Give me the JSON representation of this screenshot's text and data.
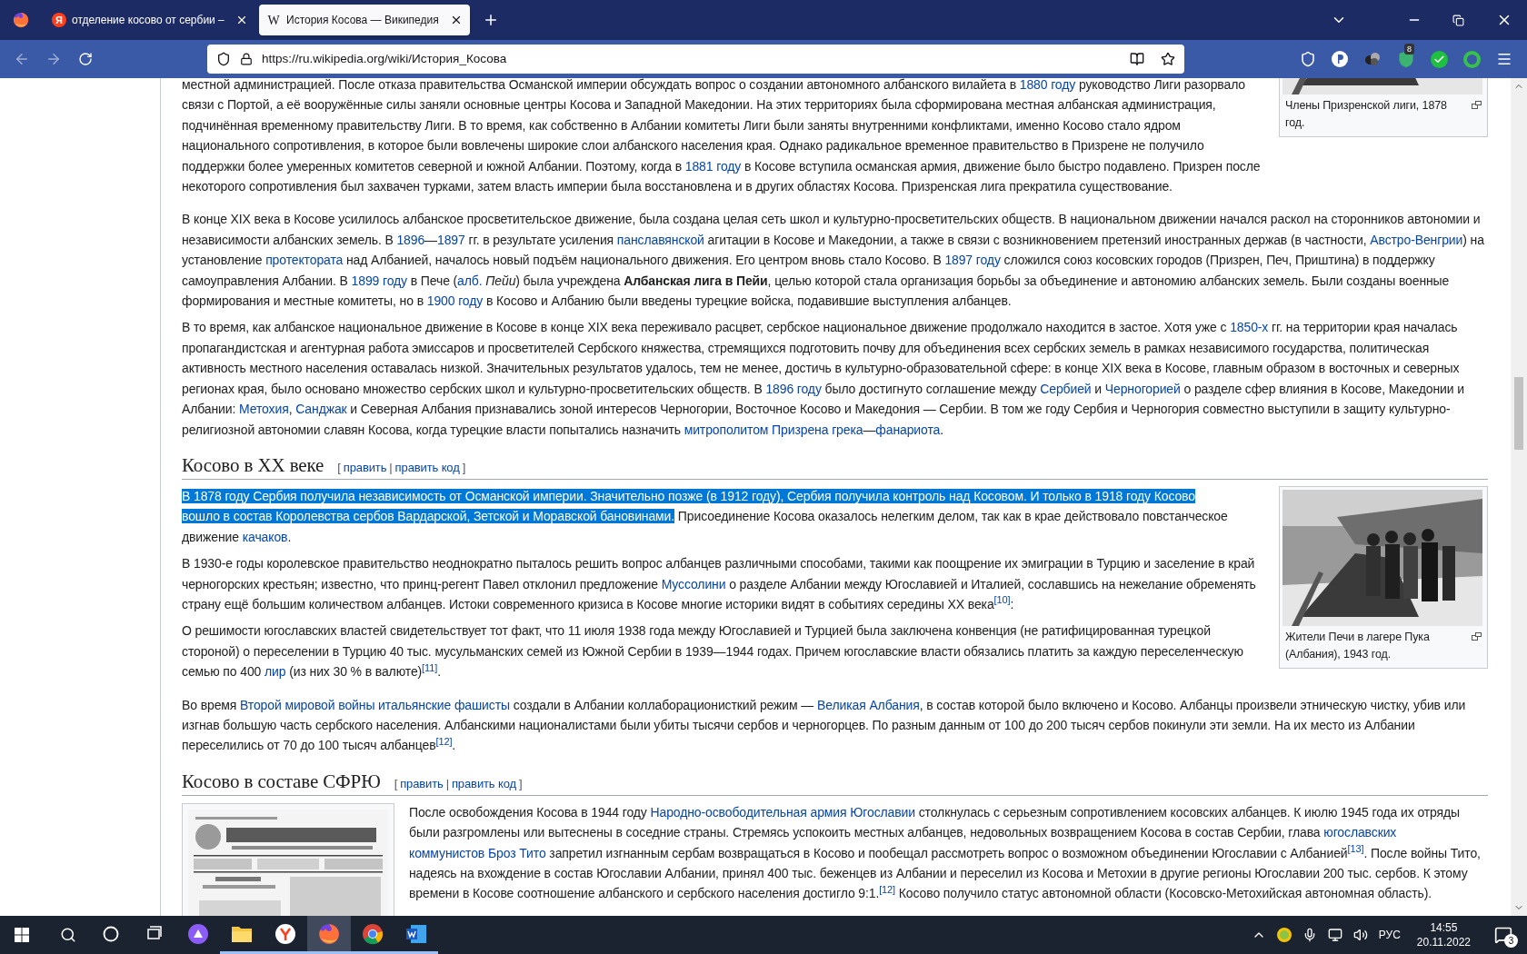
{
  "browser": {
    "tabs": [
      {
        "favicon": "Я",
        "title": "отделение косово от сербии –",
        "selected": false
      },
      {
        "favicon": "W",
        "title": "История Косова — Википедия",
        "selected": true
      }
    ],
    "url": "https://ru.wikipedia.org/wiki/История_Косова",
    "extension_badge": "8"
  },
  "article": {
    "intro": {
      "figure": {
        "caption": "Члены Призренской лиги, 1878 год."
      },
      "paragraphs": [
        {
          "segments": [
            {
              "kind": "text",
              "text": "местной администрацией. После отказа правительства Османской империи обсуждать вопрос о создании автономного албанского вилайета в "
            },
            {
              "kind": "link",
              "text": "1880 году"
            },
            {
              "kind": "text",
              "text": " руководство Лиги разорвало связи с Портой, а её вооружённые силы заняли основные центры Косова и Западной Македонии. На этих территориях была сформирована местная албанская администрация, подчинённая временному правительству Лиги. В то время, как собственно в Албании комитеты Лиги были заняты внутренними конфликтами, именно Косово стало ядром национального сопротивления, в которое были вовлечены широкие слои албанского населения края. Однако радикальное временное правительство в Призрене не получило поддержки более умеренных комитетов северной и южной Албании. Поэтому, когда в "
            },
            {
              "kind": "link",
              "text": "1881 году"
            },
            {
              "kind": "text",
              "text": " в Косове вступила османская армия, движение было быстро подавлено. Призрен после некоторого сопротивления был захвачен турками, затем власть империи была восстановлена и в других областях Косова. Призренская лига прекратила существование."
            }
          ]
        },
        {
          "segments": [
            {
              "kind": "text",
              "text": "В конце XIX века в Косове усилилось албанское просветительское движение, была создана целая сеть школ и культурно-просветительских обществ. В национальном движении начался раскол на сторонников автономии и независимости албанских земель. В "
            },
            {
              "kind": "link",
              "text": "1896"
            },
            {
              "kind": "text",
              "text": "—"
            },
            {
              "kind": "link",
              "text": "1897"
            },
            {
              "kind": "text",
              "text": " гг. в результате усиления "
            },
            {
              "kind": "link",
              "text": "панславянской"
            },
            {
              "kind": "text",
              "text": " агитации в Косове и Македонии, а также в связи с возникновением претензий иностранных держав (в частности, "
            },
            {
              "kind": "link",
              "text": "Австро-Венгрии"
            },
            {
              "kind": "text",
              "text": ") на установление "
            },
            {
              "kind": "link",
              "text": "протектората"
            },
            {
              "kind": "text",
              "text": " над Албанией, началось новый подъём национального движения. Его центром вновь стало Косово. В "
            },
            {
              "kind": "link",
              "text": "1897 году"
            },
            {
              "kind": "text",
              "text": " сложился союз косовских городов (Призрен, Печ, Приштина) в поддержку самоуправления Албании. В "
            },
            {
              "kind": "link",
              "text": "1899 году"
            },
            {
              "kind": "text",
              "text": " в Пече ("
            },
            {
              "kind": "link",
              "text": "алб."
            },
            {
              "kind": "space"
            },
            {
              "kind": "italic",
              "text": "Пейи"
            },
            {
              "kind": "text",
              "text": ") была учреждена "
            },
            {
              "kind": "bold",
              "text": "Албанская лига в Пейи"
            },
            {
              "kind": "text",
              "text": ", целью которой стала организация борьбы за объединение и автономию албанских земель. Были созданы военные формирования и местные комитеты, но в "
            },
            {
              "kind": "link",
              "text": "1900 году"
            },
            {
              "kind": "text",
              "text": " в Косово и Албанию были введены турецкие войска, подавившие выступления албанцев."
            }
          ]
        },
        {
          "segments": [
            {
              "kind": "text",
              "text": "В то время, как албанское национальное движение в Косове в конце XIX века переживало расцвет, сербское национальное движение продолжало находится в застое. Хотя уже с "
            },
            {
              "kind": "link",
              "text": "1850-х"
            },
            {
              "kind": "text",
              "text": " гг. на территории края началась пропагандистская и агентурная работа эмиссаров и просветителей Сербского княжества, стремящихся подготовить почву для объединения всех сербских земель в рамках независимого государства, политическая активность местного населения оставалась низкой. Значительных результатов удалось, тем не менее, достичь в культурно-образовательной сфере: в конце XIX века в Косове, главным образом в восточных и северных регионах края, было основано множество сербских школ и культурно-просветительских обществ. В "
            },
            {
              "kind": "link",
              "text": "1896 году"
            },
            {
              "kind": "text",
              "text": " было достигнуто соглашение между "
            },
            {
              "kind": "link",
              "text": "Сербией"
            },
            {
              "kind": "text",
              "text": " и "
            },
            {
              "kind": "link",
              "text": "Черногорией"
            },
            {
              "kind": "text",
              "text": " о разделе сфер влияния в Косове, Македонии и Албании: "
            },
            {
              "kind": "link",
              "text": "Метохия"
            },
            {
              "kind": "text",
              "text": ", "
            },
            {
              "kind": "link",
              "text": "Санджак"
            },
            {
              "kind": "text",
              "text": " и Северная Албания признавались зоной интересов Черногории, Восточное Косово и Македония — Сербии. В том же году Сербия и Черногория совместно выступили в защиту культурно-религиозной автономии славян Косова, когда турецкие власти попытались назначить "
            },
            {
              "kind": "link",
              "text": "митрополитом Призрена"
            },
            {
              "kind": "space"
            },
            {
              "kind": "link",
              "text": "грека"
            },
            {
              "kind": "text",
              "text": "—"
            },
            {
              "kind": "link",
              "text": "фанариота"
            },
            {
              "kind": "text",
              "text": "."
            }
          ]
        }
      ]
    },
    "sections": [
      {
        "heading": "Косово в XX веке",
        "edit": [
          {
            "kind": "mark",
            "text": "["
          },
          {
            "kind": "link",
            "text": "править"
          },
          {
            "kind": "mark",
            "text": "|"
          },
          {
            "kind": "link",
            "text": "править код"
          },
          {
            "kind": "mark",
            "text": "]"
          }
        ],
        "figure": {
          "caption": "Жители Печи в лагере Пука (Албания), 1943 год."
        },
        "paragraphs": [
          {
            "segments": [
              {
                "kind": "selected",
                "text": "В 1878 году Сербия получила независимость от Османской империи. Значительно позже (в 1912 году), Сербия получила контроль над Косовом. И только в 1918 году Косово"
              },
              {
                "kind": "space"
              },
              {
                "kind": "selected",
                "text": "вошло в состав Королевства сербов Вардарской, Зетской и Моравской бановинами."
              },
              {
                "kind": "text",
                "text": " Присоединение Косова оказалось нелегким делом, так как в крае действовало повстанческое движение "
              },
              {
                "kind": "link",
                "text": "качаков"
              },
              {
                "kind": "text",
                "text": "."
              }
            ]
          },
          {
            "segments": [
              {
                "kind": "text",
                "text": "В 1930-е годы королевское правительство неоднократно пыталось решить вопрос албанцев различными способами, такими как поощрение их эмиграции в Турцию и заселение в край черногорских крестьян; известно, что принц-регент Павел отклонил предложение "
              },
              {
                "kind": "link",
                "text": "Муссолини"
              },
              {
                "kind": "text",
                "text": " о разделе Албании между Югославией и Италией, сославшись на нежелание обременять страну ещё большим количеством албанцев. Истоки современного кризиса в Косове многие историки видят в событиях середины XX века"
              },
              {
                "kind": "ref",
                "text": "[10]"
              },
              {
                "kind": "text",
                "text": ":"
              }
            ]
          },
          {
            "segments": [
              {
                "kind": "text",
                "text": "О решимости югославских властей свидетельствует тот факт, что 11 июля 1938 года между Югославией и Турцией была заключена конвенция (не ратифицированная турецкой стороной) о переселении в Турцию 40 тыс. мусульманских семей из Южной Сербии в 1939—1944 годах. Причем югославские власти обязались платить за каждую переселенческую семью по 400 "
              },
              {
                "kind": "link",
                "text": "лир"
              },
              {
                "kind": "text",
                "text": " (из них 30 % в валюте)"
              },
              {
                "kind": "ref",
                "text": "[11]"
              },
              {
                "kind": "text",
                "text": "."
              }
            ]
          },
          {
            "segments": [
              {
                "kind": "text",
                "text": "Во время "
              },
              {
                "kind": "link",
                "text": "Второй мировой войны"
              },
              {
                "kind": "space"
              },
              {
                "kind": "link",
                "text": "итальянские фашисты"
              },
              {
                "kind": "text",
                "text": " создали в Албании коллаборационисткий режим — "
              },
              {
                "kind": "link",
                "text": "Великая Албания"
              },
              {
                "kind": "text",
                "text": ", в состав которой было включено и Косово. Албанцы произвели этническую чистку, убив или изгнав большую часть сербского населения. Албанскими националистами были убиты тысячи сербов и черногорцев. По разным данным от 100 до 200 тысяч сербов покинули эти земли. На их место из Албании переселились от 70 до 100 тысяч албанцев"
              },
              {
                "kind": "ref",
                "text": "[12]"
              },
              {
                "kind": "text",
                "text": "."
              }
            ]
          }
        ]
      },
      {
        "heading": "Косово в составе СФРЮ",
        "edit": [
          {
            "kind": "mark",
            "text": "["
          },
          {
            "kind": "link",
            "text": "править"
          },
          {
            "kind": "mark",
            "text": "|"
          },
          {
            "kind": "link",
            "text": "править код"
          },
          {
            "kind": "mark",
            "text": "]"
          }
        ],
        "figure": {
          "kind": "picture"
        },
        "paragraphs": [
          {
            "segments": [
              {
                "kind": "text",
                "text": "После освобождения Косова в 1944 году "
              },
              {
                "kind": "link",
                "text": "Народно-освободительная армия Югославии"
              },
              {
                "kind": "text",
                "text": " столкнулась с серьезным сопротивлением косовских албанцев. К июлю 1945 года их отряды были разгромлены или вытеснены в соседние страны. Стремясь успокоить местных албанцев, недовольных возвращением Косова в состав Сербии, глава "
              },
              {
                "kind": "link",
                "text": "югославских"
              },
              {
                "kind": "space"
              },
              {
                "kind": "link",
                "text": "коммунистов Броз Тито"
              },
              {
                "kind": "text",
                "text": " запретил изгнанным сербам возвращаться в Косово и пообещал рассмотреть вопрос о возможном объединении Югославии с Албанией"
              },
              {
                "kind": "ref",
                "text": "[13]"
              },
              {
                "kind": "text",
                "text": ". После войны Тито, надеясь на вхождение в состав Югославии Албании, принял 400 тыс. беженцев из Албании и переселил из Косова и Метохии в другие регионы Югославии 200 тыс. сербов. К этому времени в Косове соотношение албанского и сербского населения достигло 9:1."
              },
              {
                "kind": "ref",
                "text": "[12]"
              },
              {
                "kind": "text",
                "text": " Косово получило статус автономной области (Косовско-Метохийская автономная область)."
              }
            ]
          }
        ]
      }
    ]
  },
  "taskbar": {
    "apps": [
      {
        "running": false,
        "selected": false
      },
      {
        "running": true,
        "selected": false
      },
      {
        "running": true,
        "selected": false
      },
      {
        "running": true,
        "selected": true
      },
      {
        "running": true,
        "selected": false
      },
      {
        "running": true,
        "selected": false
      }
    ],
    "language": "РУС",
    "time": "14:55",
    "date": "20.11.2022",
    "notifications": "3"
  }
}
